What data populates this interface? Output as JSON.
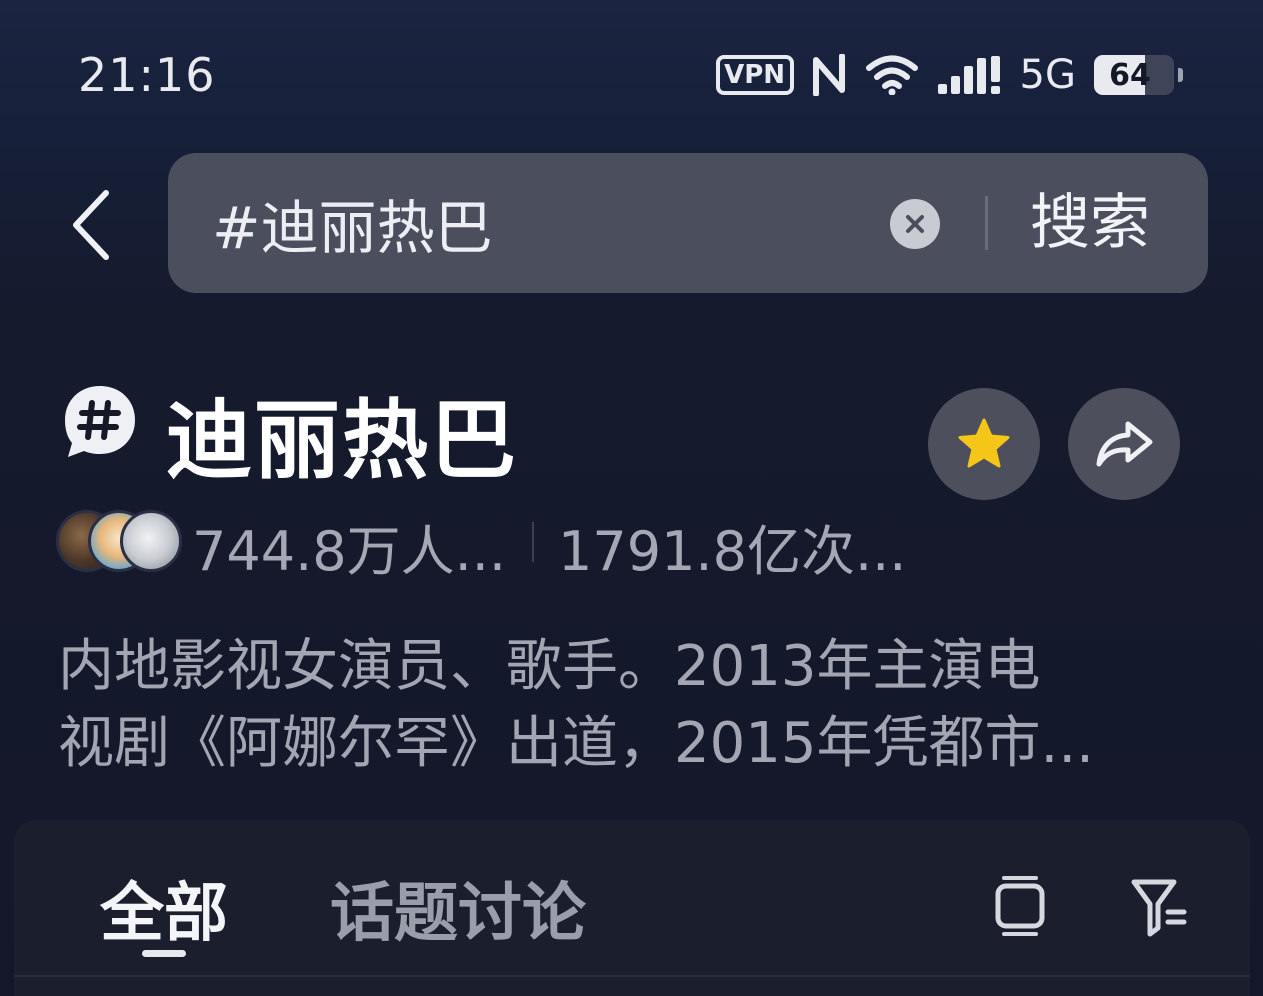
{
  "status_bar": {
    "time": "21:16",
    "vpn_label": "VPN",
    "network": "5G",
    "battery_level": "64",
    "icons": [
      "vpn-icon",
      "nfc-icon",
      "wifi-icon",
      "signal-icon",
      "battery-icon"
    ]
  },
  "search": {
    "query": "#迪丽热巴",
    "submit_label": "搜索"
  },
  "topic": {
    "title": "迪丽热巴",
    "followers": "744.8万人...",
    "views": "1791.8亿次...",
    "description_line1": "内地影视女演员、歌手。2013年主演电",
    "description_line2": "视剧《阿娜尔罕》出道，2015年凭都市..."
  },
  "tabs": [
    {
      "label": "全部",
      "active": true
    },
    {
      "label": "话题讨论",
      "active": false
    }
  ],
  "colors": {
    "accent_star": "#f5c518",
    "background": "#151827",
    "search_box": "#4b4e5c"
  }
}
